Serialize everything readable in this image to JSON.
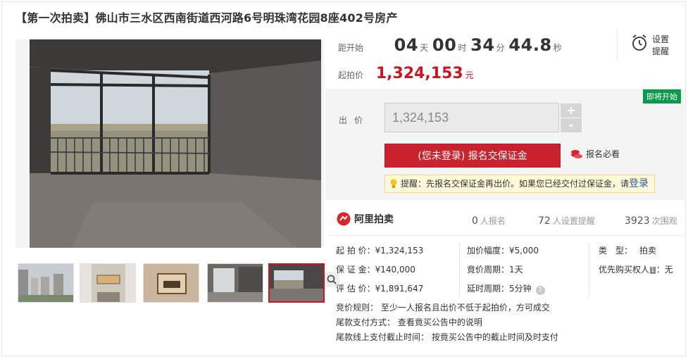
{
  "title": "【第一次拍卖】佛山市三水区西南街道西河路6号明珠湾花园8座402号房产",
  "countdown": {
    "label": "距开始",
    "days": "04",
    "days_unit": "天",
    "hours": "00",
    "hours_unit": "时",
    "minutes": "34",
    "minutes_unit": "分",
    "seconds": "44.8",
    "seconds_unit": "秒"
  },
  "alarm": {
    "label": "设置提醒"
  },
  "start_price": {
    "label": "起拍价",
    "value": "1,324,153",
    "unit": "元"
  },
  "bid": {
    "status_badge": "即将开始",
    "label": "出价",
    "input_value": "1,324,153",
    "plus": "+",
    "minus": "-",
    "register_button": "(您未登录) 报名交保证金",
    "must_read": "报名必看",
    "tip_text": "提醒：先报名交保证金再出价。如果您已经交付过保证金，请",
    "tip_login": "登录"
  },
  "platform": {
    "name": "阿里拍卖"
  },
  "stats": {
    "signups": "0",
    "signups_label": "人报名",
    "reminders": "72",
    "reminders_label": "人设置提醒",
    "views": "3923",
    "views_label": "次围观"
  },
  "details": {
    "start_price": "起 拍 价：¥1,324,153",
    "deposit": "保 证 金：¥140,000",
    "appraisal": "评 估 价：¥1,891,647",
    "increment": "加价幅度：¥5,000",
    "bid_period": "竟价周期：1天",
    "delay_period": "延时周期：5分钟",
    "type_label": "类　型：",
    "type_value": "拍卖",
    "priority_pre": "优先购买权人",
    "priority_tag": "1",
    "priority_post": "：无",
    "rule": "竞价规则：  至少一人报名且出价不低于起拍价，方可成交",
    "payment": "尾款支付方式：  查看竟买公告中的说明",
    "deadline": "尾款线上支付截止时间：  按竟买公告中的截止时间及时支付"
  },
  "colors": {
    "accent": "#c81623",
    "badge": "#0b9a4b",
    "link": "#2f5d9c"
  },
  "icons": [
    "zoom-icon",
    "alarm-clock-icon",
    "coins-icon",
    "lightbulb-icon",
    "ali-auction-logo",
    "help-icon"
  ]
}
